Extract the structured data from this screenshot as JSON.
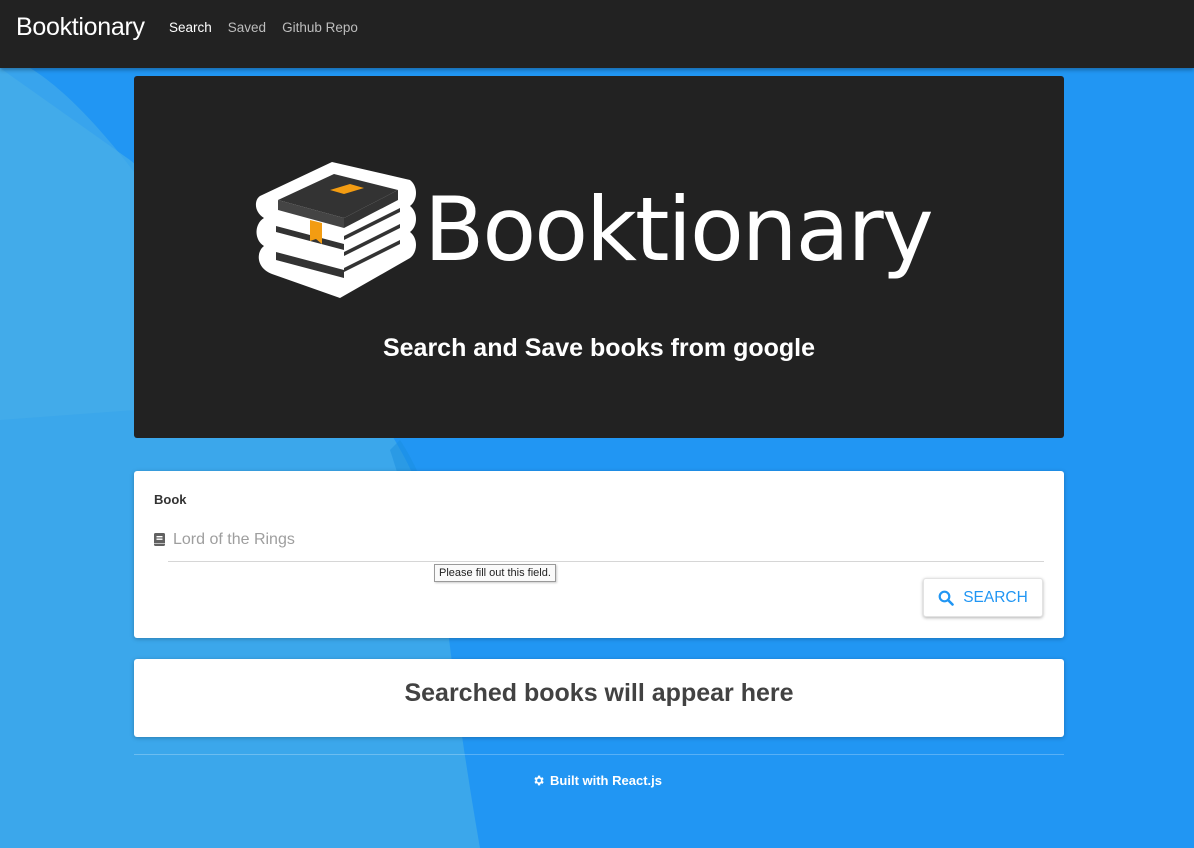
{
  "navbar": {
    "brand": "Booktionary",
    "links": [
      {
        "label": "Search",
        "active": true
      },
      {
        "label": "Saved",
        "active": false
      },
      {
        "label": "Github Repo",
        "active": false
      }
    ]
  },
  "hero": {
    "logo_text": "Booktionary",
    "tagline": "Search and Save books from google"
  },
  "search_form": {
    "label": "Book",
    "input_value": "",
    "placeholder": "Lord of the Rings",
    "validation_tooltip": "Please fill out this field.",
    "button_label": "SEARCH"
  },
  "results": {
    "empty_message": "Searched books will appear here"
  },
  "footer": {
    "text": "Built with React.js"
  },
  "icons": {
    "input_icon": "book-icon",
    "button_icon": "search-icon",
    "footer_icon": "gear-icon"
  },
  "colors": {
    "navbar": "#222222",
    "background": "#2196f3",
    "accent": "#2196f3",
    "bookmark": "#f39c12"
  }
}
